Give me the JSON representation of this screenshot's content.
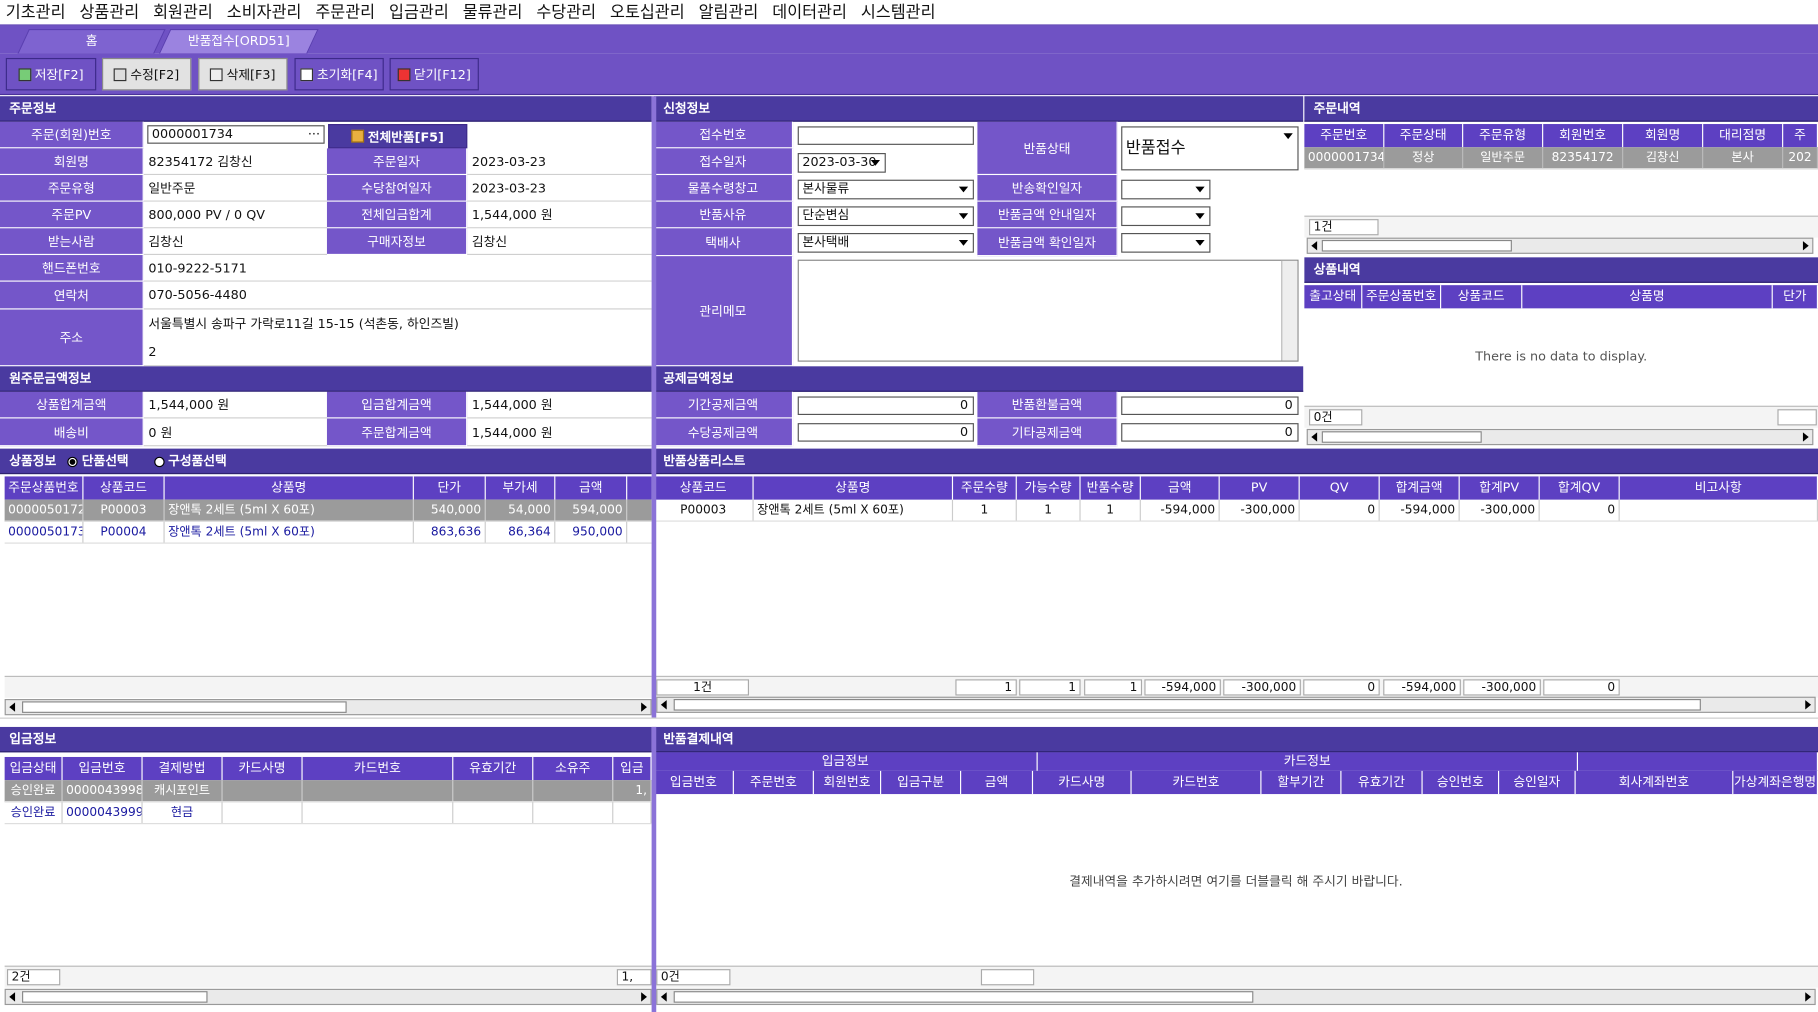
{
  "menu": [
    "기초관리",
    "상품관리",
    "회원관리",
    "소비자관리",
    "주문관리",
    "입금관리",
    "물류관리",
    "수당관리",
    "오토십관리",
    "알림관리",
    "데이터관리",
    "시스템관리"
  ],
  "tabs": {
    "home": "홈",
    "active": "반품접수[ORD51]"
  },
  "toolbar": {
    "save": "저장[F2]",
    "edit": "수정[F2]",
    "delete": "삭제[F3]",
    "reset": "초기화[F4]",
    "close": "닫기[F12]"
  },
  "order": {
    "title": "주문정보",
    "order_no_label": "주문(회원)번호",
    "order_no": "0000001734",
    "full_return": "전체반품[F5]",
    "member_label": "회원명",
    "member": "82354172 김창신",
    "order_date_label": "주문일자",
    "order_date": "2023-03-23",
    "type_label": "주문유형",
    "type": "일반주문",
    "commission_date_label": "수당참여일자",
    "commission_date": "2023-03-23",
    "pv_label": "주문PV",
    "pv": "800,000 PV / 0 QV",
    "total_deposit_label": "전체입금합계",
    "total_deposit": "1,544,000 원",
    "receiver_label": "받는사람",
    "receiver": "김창신",
    "buyer_label": "구매자정보",
    "buyer": "김창신",
    "mobile_label": "핸드폰번호",
    "mobile": "010-9222-5171",
    "phone_label": "연락처",
    "phone": "070-5056-4480",
    "address_label": "주소",
    "address1": "서울특별시 송파구 가락로11길 15-15 (석촌동, 하인즈빌)",
    "address2": "2"
  },
  "original": {
    "title": "원주문금액정보",
    "product_total_label": "상품합계금액",
    "product_total": "1,544,000 원",
    "deposit_total_label": "입금합계금액",
    "deposit_total": "1,544,000 원",
    "shipping_label": "배송비",
    "shipping": "0 원",
    "order_total_label": "주문합계금액",
    "order_total": "1,544,000 원"
  },
  "request": {
    "title": "신청정보",
    "receipt_no_label": "접수번호",
    "receipt_no": "",
    "receipt_date_label": "접수일자",
    "receipt_date": "2023-03-30",
    "status_label": "반품상태",
    "status": "반품접수",
    "warehouse_label": "물품수령창고",
    "warehouse": "본사물류",
    "return_confirm_label": "반송확인일자",
    "reason_label": "반품사유",
    "reason": "단순변심",
    "notice_date_label": "반품금액 안내일자",
    "courier_label": "택배사",
    "courier": "본사택배",
    "amount_confirm_label": "반품금액 확인일자",
    "memo_label": "관리메모"
  },
  "deduction": {
    "title": "공제금액정보",
    "period_label": "기간공제금액",
    "period": "0",
    "refund_label": "반품환불금액",
    "refund": "0",
    "commission_label": "수당공제금액",
    "commission": "0",
    "other_label": "기타공제금액",
    "other": "0"
  },
  "order_list": {
    "title": "주문내역",
    "headers": [
      "주문번호",
      "주문상태",
      "주문유형",
      "회원번호",
      "회원명",
      "대리점명",
      "주"
    ],
    "rows": [
      [
        "0000001734",
        "정상",
        "일반주문",
        "82354172",
        "김창신",
        "본사",
        "202"
      ]
    ],
    "count": "1건"
  },
  "product_list": {
    "title": "상품내역",
    "headers": [
      "출고상태",
      "주문상품번호",
      "상품코드",
      "상품명",
      "단가"
    ],
    "empty": "There is no data to display.",
    "count": "0건"
  },
  "product_info": {
    "title": "상품정보",
    "opt_single": "단품선택",
    "opt_set": "구성품선택",
    "headers": [
      "주문상품번호",
      "상품코드",
      "상품명",
      "단가",
      "부가세",
      "금액"
    ],
    "rows": [
      [
        "0000050172",
        "P00003",
        "장앤톡 2세트 (5ml X 60포)",
        "540,000",
        "54,000",
        "594,000"
      ],
      [
        "0000050173",
        "P00004",
        "장앤톡 2세트 (5ml X 60포)",
        "863,636",
        "86,364",
        "950,000"
      ]
    ]
  },
  "return_list": {
    "title": "반품상품리스트",
    "headers": [
      "상품코드",
      "상품명",
      "주문수량",
      "가능수량",
      "반품수량",
      "금액",
      "PV",
      "QV",
      "합계금액",
      "합계PV",
      "합계QV",
      "비고사항"
    ],
    "rows": [
      [
        "P00003",
        "장앤톡 2세트 (5ml X 60포)",
        "1",
        "1",
        "1",
        "-594,000",
        "-300,000",
        "0",
        "-594,000",
        "-300,000",
        "0",
        ""
      ]
    ],
    "footer": {
      "count": "1건",
      "qty": "1",
      "avail": "1",
      "ret": "1",
      "amount": "-594,000",
      "pv": "-300,000",
      "qv": "0",
      "sum_amount": "-594,000",
      "sum_pv": "-300,000",
      "sum_qv": "0"
    }
  },
  "deposit": {
    "title": "입금정보",
    "headers": [
      "입금상태",
      "입금번호",
      "결제방법",
      "카드사명",
      "카드번호",
      "유효기간",
      "소유주",
      "입금"
    ],
    "rows": [
      [
        "승인완료",
        "0000043998",
        "캐시포인트",
        "",
        "",
        "",
        "",
        "1,"
      ],
      [
        "승인완료",
        "0000043999",
        "현금",
        "",
        "",
        "",
        "",
        ""
      ]
    ],
    "count": "2건",
    "foot_right": "1,"
  },
  "payment": {
    "title": "반품결제내역",
    "group1": "입금정보",
    "group2": "카드정보",
    "headers": [
      "입금번호",
      "주문번호",
      "회원번호",
      "입금구분",
      "금액",
      "카드사명",
      "카드번호",
      "할부기간",
      "유효기간",
      "승인번호",
      "승인일자",
      "회사계좌번호",
      "가상계좌은행명"
    ],
    "empty": "결제내역을 추가하시려면 여기를 더블클릭 해 주시기 바랍니다.",
    "count": "0건"
  }
}
